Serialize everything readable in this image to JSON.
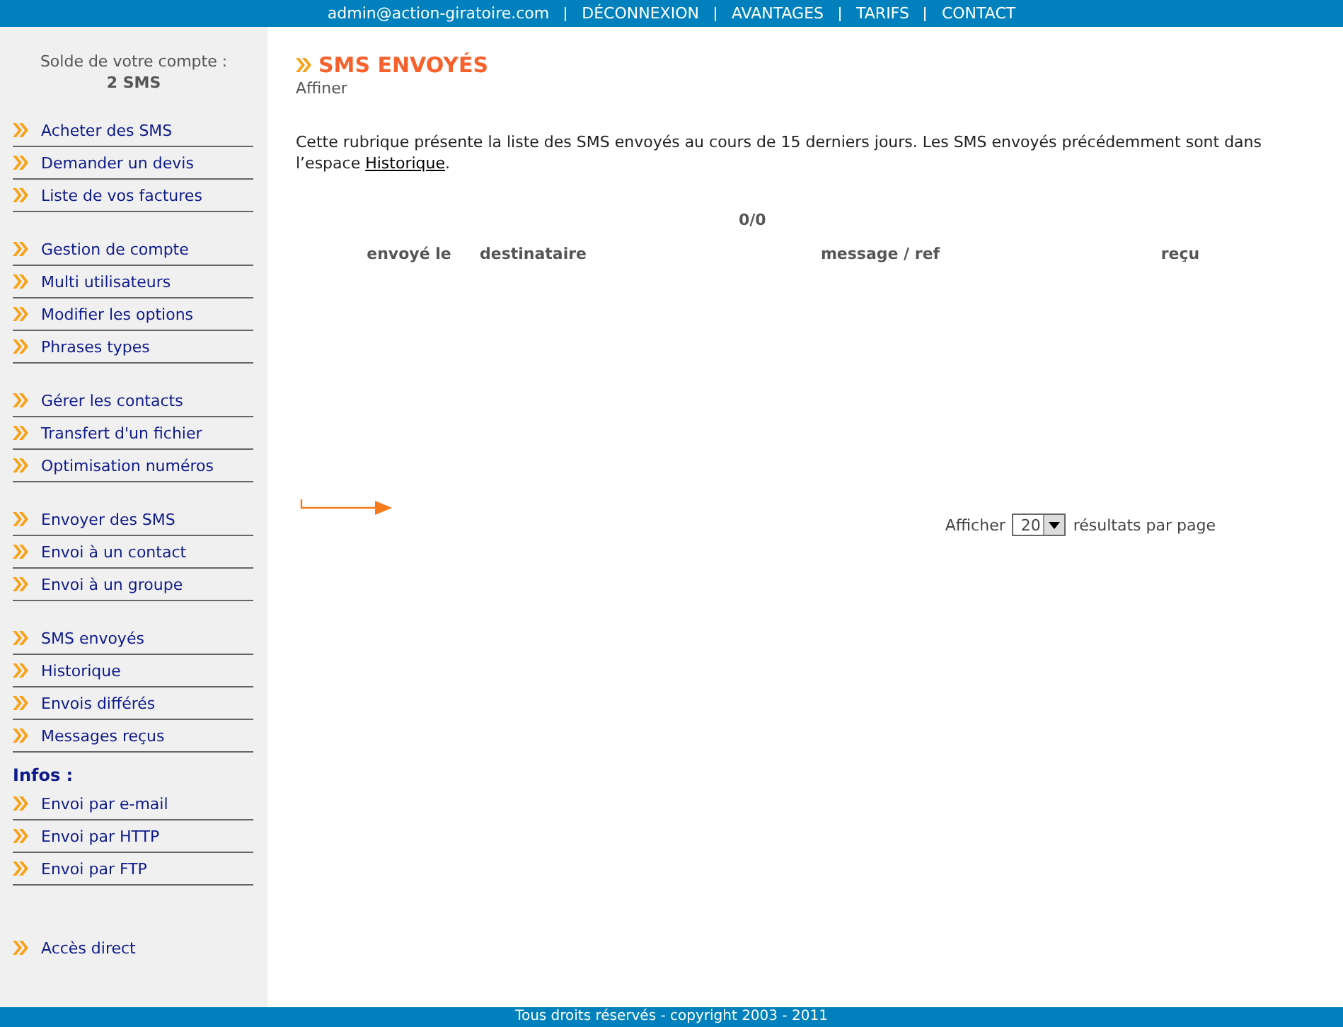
{
  "top_bar": {
    "email": "admin@action-giratoire.com",
    "links": [
      "DÉCONNEXION",
      "AVANTAGES",
      "TARIFS",
      "CONTACT"
    ]
  },
  "sidebar": {
    "balance_label": "Solde de votre compte :",
    "balance_value": "2 SMS",
    "groups": [
      {
        "items": [
          "Acheter des SMS",
          "Demander un devis",
          "Liste de vos factures"
        ]
      },
      {
        "items": [
          "Gestion de compte",
          "Multi utilisateurs",
          "Modifier les options",
          "Phrases types"
        ]
      },
      {
        "items": [
          "Gérer les contacts",
          "Transfert d'un fichier",
          "Optimisation numéros"
        ]
      },
      {
        "items": [
          "Envoyer des SMS",
          "Envoi à un contact",
          "Envoi à un groupe"
        ]
      },
      {
        "items": [
          "SMS envoyés",
          "Historique",
          "Envois différés",
          "Messages reçus"
        ]
      },
      {
        "heading": "Infos :",
        "items": [
          "Envoi par e-mail",
          "Envoi par HTTP",
          "Envoi par FTP"
        ]
      }
    ],
    "direct_link": "Accès direct"
  },
  "main": {
    "title": "SMS ENVOYÉS",
    "subtitle": "Affiner",
    "intro": {
      "text": "Cette rubrique présente la liste des SMS envoyés au cours de 15 derniers jours. Les SMS envoyés précédemment sont dans l’espace ",
      "link": "Historique",
      "after": "."
    },
    "count": "0/0",
    "table": {
      "columns": [
        "envoyé le",
        "destinataire",
        "message / ref",
        "reçu"
      ]
    },
    "pager": {
      "label": "Afficher",
      "value": "20",
      "suffix": "résultats par page"
    }
  },
  "footer": "Tous droits réservés - copyright 2003 - 2011"
}
